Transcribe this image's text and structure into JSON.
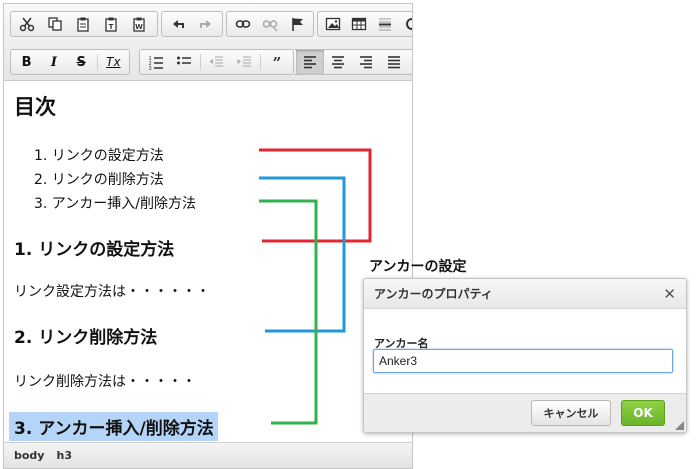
{
  "toolbar": {
    "row1": [
      "cut-icon",
      "copy-icon",
      "paste-icon",
      "paste-text-icon",
      "paste-word-icon",
      "undo-icon",
      "redo-icon",
      "link-icon",
      "unlink-icon",
      "anchor-icon",
      "image-icon",
      "table-icon",
      "horizontal-line-icon",
      "special-char-icon"
    ],
    "row2": {
      "bold": "B",
      "italic": "I",
      "strike": "S",
      "remove_format": "Tx"
    }
  },
  "content": {
    "heading": "目次",
    "toc": [
      "1. リンクの設定方法",
      "2. リンクの削除方法",
      "3. アンカー挿入/削除方法"
    ],
    "section1_title": "1. リンクの設定方法",
    "section1_body": "リンク設定方法は・・・・・・",
    "section2_title": "2. リンク削除方法",
    "section2_body": "リンク削除方法は・・・・・",
    "section3_title": "3. アンカー挿入/削除方法"
  },
  "statusbar": {
    "path": [
      "body",
      "h3"
    ]
  },
  "annotation": {
    "caption": "アンカーの設定"
  },
  "dialog": {
    "title": "アンカーのプロパティ",
    "close": "✕",
    "field_label": "アンカー名",
    "field_value": "Anker3",
    "cancel_label": "キャンセル",
    "ok_label": "OK"
  },
  "colors": {
    "red": "#e0262f",
    "blue": "#1f9ad6",
    "green": "#33b14a",
    "highlight": "#b5d5f8",
    "ok": "#76bd30"
  }
}
